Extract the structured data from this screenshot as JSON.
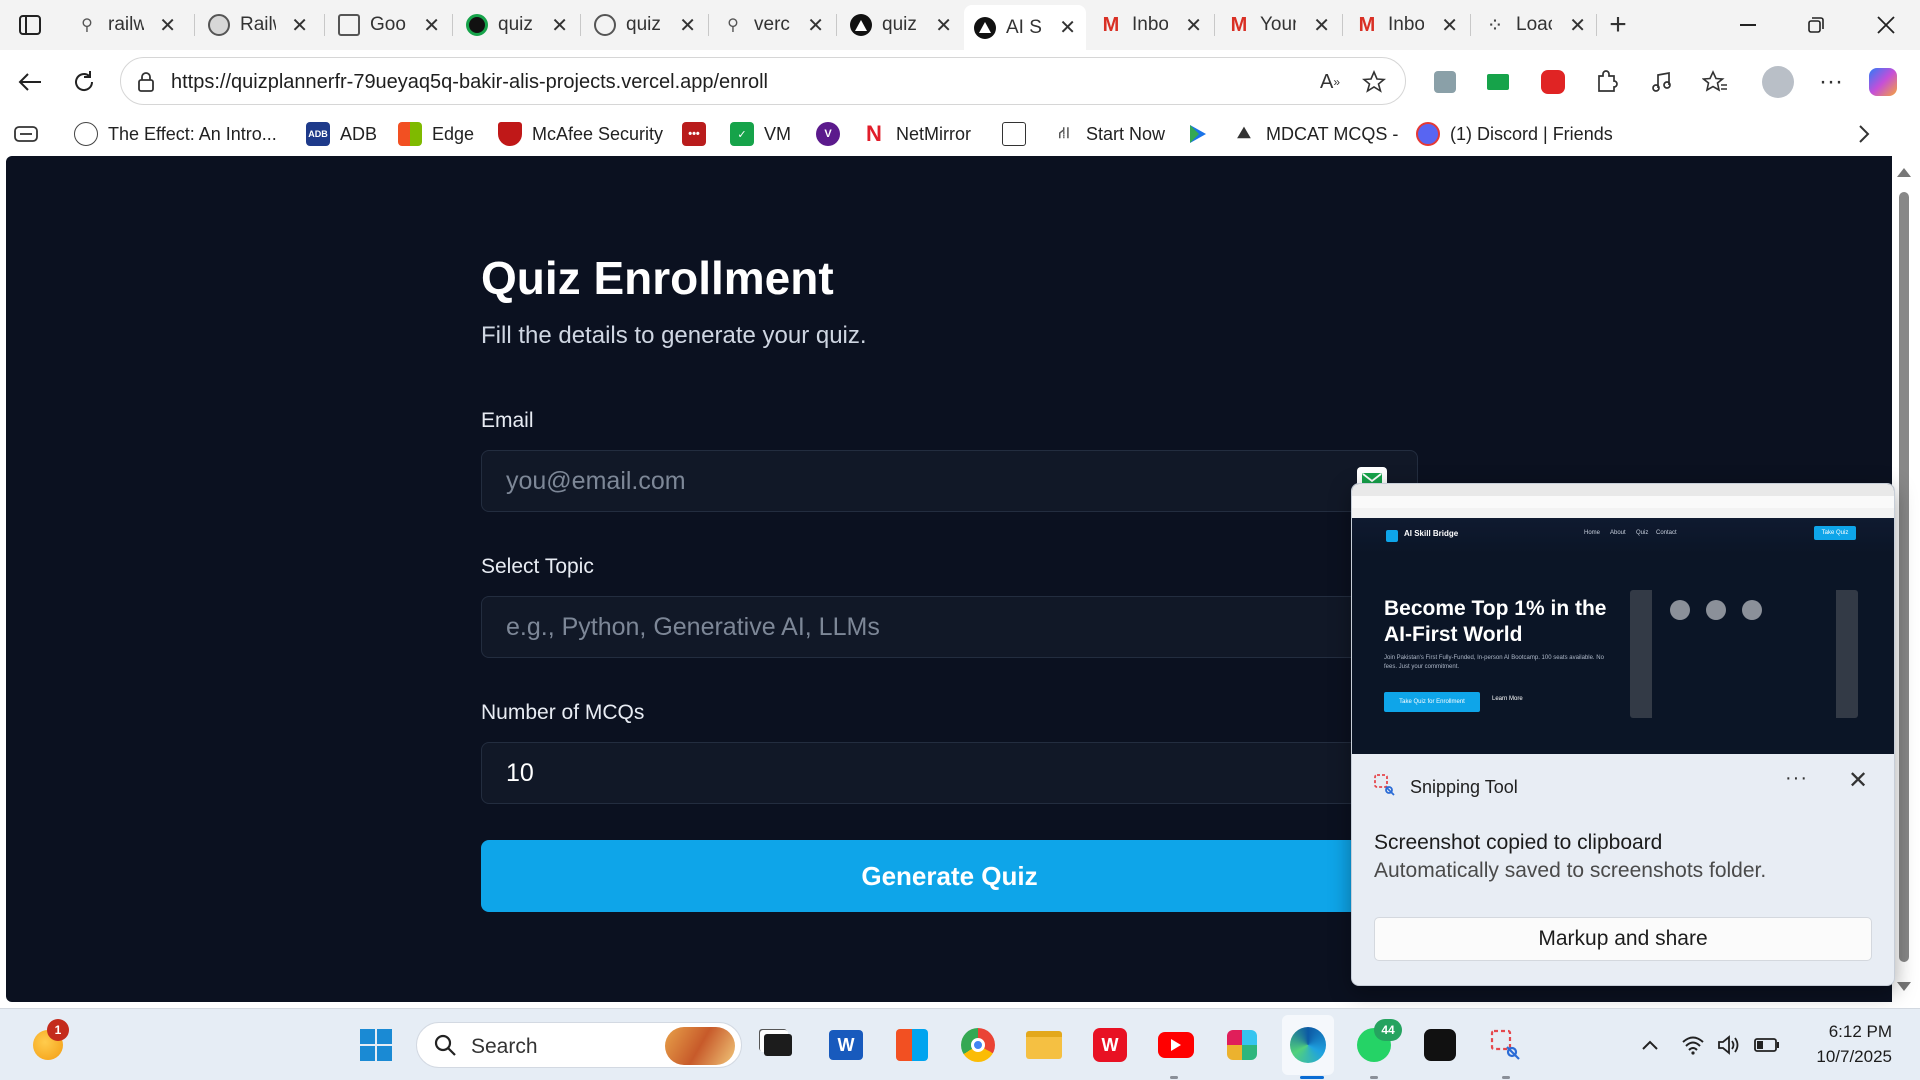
{
  "browser": {
    "tabs": [
      {
        "title": "railw",
        "icon": "search-icon"
      },
      {
        "title": "Railw",
        "icon": "railway-icon"
      },
      {
        "title": "Goo",
        "icon": "doc-icon"
      },
      {
        "title": "quiz",
        "icon": "circle-logo-icon"
      },
      {
        "title": "quiz",
        "icon": "globe-icon"
      },
      {
        "title": "verc",
        "icon": "search-icon"
      },
      {
        "title": "quiz",
        "icon": "vercel-icon"
      },
      {
        "title": "AI Sl",
        "icon": "vercel-icon",
        "active": true
      },
      {
        "title": "Inbo",
        "icon": "gmail-icon"
      },
      {
        "title": "Your",
        "icon": "gmail-icon"
      },
      {
        "title": "Inbo",
        "icon": "gmail-icon"
      },
      {
        "title": "Loac",
        "icon": "loading-icon"
      }
    ],
    "url": "https://quizplannerfr-79ueyaq5q-bakir-alis-projects.vercel.app/enroll",
    "favorites": [
      {
        "label": "The Effect: An Intro...",
        "icon": "globe-icon"
      },
      {
        "label": "ADB",
        "icon": "adb-icon"
      },
      {
        "label": "Edge",
        "icon": "windows-icon"
      },
      {
        "label": "McAfee Security",
        "icon": "mcafee-icon"
      },
      {
        "label": "",
        "icon": "red-app-icon"
      },
      {
        "label": "VM",
        "icon": "check-icon"
      },
      {
        "label": "",
        "icon": "v-logo-icon"
      },
      {
        "label": "NetMirror",
        "icon": "netmirror-icon"
      },
      {
        "label": "",
        "icon": "calendar-icon"
      },
      {
        "label": "Start Now",
        "icon": "tree-icon"
      },
      {
        "label": "",
        "icon": "play-icon"
      },
      {
        "label": "MDCAT MCQS -",
        "icon": "mdcat-icon"
      },
      {
        "label": "(1) Discord | Friends",
        "icon": "discord-icon"
      }
    ]
  },
  "page": {
    "title": "Quiz Enrollment",
    "subtitle": "Fill the details to generate your quiz.",
    "email_label": "Email",
    "email_placeholder": "you@email.com",
    "topic_label": "Select Topic",
    "topic_placeholder": "e.g., Python, Generative AI, LLMs",
    "mcq_label": "Number of MCQs",
    "mcq_value": "10",
    "submit_label": "Generate Quiz"
  },
  "toast": {
    "app_name": "Snipping Tool",
    "message": "Screenshot copied to clipboard",
    "detail": "Automatically saved to screenshots folder.",
    "action_label": "Markup and share",
    "preview": {
      "brand": "AI Skill Bridge",
      "nav": [
        "Home",
        "About",
        "Quiz",
        "Contact"
      ],
      "cta": "Take Quiz",
      "headline": "Become Top 1% in the AI-First World",
      "description": "Join Pakistan's First Fully-Funded, In-person AI Bootcamp. 100 seats available. No fees. Just your commitment.",
      "primary_button": "Take Quiz for Enrollment",
      "secondary_button": "Learn More"
    }
  },
  "taskbar": {
    "search_label": "Search",
    "time": "6:12 PM",
    "date": "10/7/2025",
    "weather_badge": "1",
    "whatsapp_badge": "44"
  },
  "colors": {
    "page_bg": "#0b1120",
    "accent": "#0ea5e9",
    "input_bg": "#111827"
  }
}
